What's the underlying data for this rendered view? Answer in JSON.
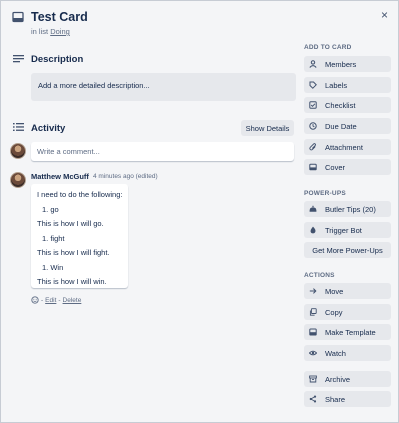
{
  "card": {
    "title": "Test Card",
    "in_list_prefix": "in list",
    "list_name": "Doing",
    "close_glyph": "×"
  },
  "description": {
    "heading": "Description",
    "placeholder": "Add a more detailed description..."
  },
  "activity": {
    "heading": "Activity",
    "show_details": "Show Details",
    "comment_placeholder": "Write a comment..."
  },
  "comment": {
    "author": "Matthew McGuff",
    "meta": "4 minutes ago (edited)",
    "lines": [
      "I need to do the following:",
      "1. go",
      "This is how I will go.",
      "1. fight",
      "This is how I will fight.",
      "1. Win",
      "This is how I will win."
    ],
    "edit": "Edit",
    "delete": "Delete",
    "sep1": "-",
    "sep2": "-"
  },
  "sidebar": {
    "add_to_card": "ADD TO CARD",
    "members": "Members",
    "labels": "Labels",
    "checklist": "Checklist",
    "due_date": "Due Date",
    "attachment": "Attachment",
    "cover": "Cover",
    "power_ups": "POWER-UPS",
    "butler_tips": "Butler Tips (20)",
    "trigger_bot": "Trigger Bot",
    "get_more_power_ups": "Get More Power-Ups",
    "actions": "ACTIONS",
    "move": "Move",
    "copy": "Copy",
    "make_template": "Make Template",
    "watch": "Watch",
    "archive": "Archive",
    "share": "Share"
  },
  "colors": {
    "background": "#f4f5f7",
    "button": "#e6e8ec",
    "text": "#172b4d",
    "muted": "#5e6c84"
  }
}
